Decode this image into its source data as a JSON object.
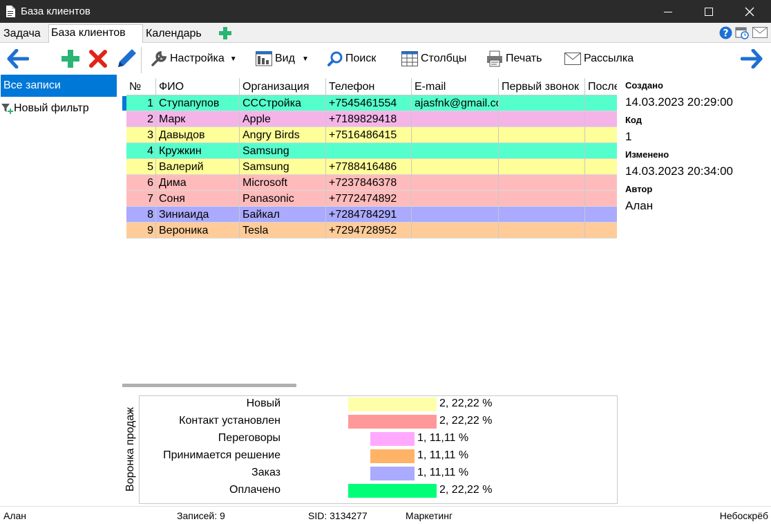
{
  "window": {
    "title": "База клиентов"
  },
  "tabs": [
    {
      "label": "Задача"
    },
    {
      "label": "База клиентов"
    },
    {
      "label": "Календарь"
    }
  ],
  "toolbar": {
    "settings_label": "Настройка",
    "view_label": "Вид",
    "search_label": "Поиск",
    "columns_label": "Столбцы",
    "print_label": "Печать",
    "mailing_label": "Рассылка"
  },
  "sidebar": {
    "all_records": "Все записи",
    "new_filter": "Новый фильтр"
  },
  "table": {
    "columns": [
      "№",
      "ФИО",
      "Организация",
      "Телефон",
      "E-mail",
      "Первый звонок",
      "Последний"
    ],
    "rows": [
      {
        "num": "1",
        "name": "Ступапупов",
        "org": "СССтройка",
        "phone": "+7545461554",
        "email": "ajasfnk@gmail.com",
        "first_call": "",
        "last": "",
        "color": "#55ffcc"
      },
      {
        "num": "2",
        "name": "Марк",
        "org": "Apple",
        "phone": "+7189829418",
        "email": "",
        "first_call": "",
        "last": "",
        "color": "#f4b4e8"
      },
      {
        "num": "3",
        "name": "Давыдов",
        "org": "Angry Birds",
        "phone": "+7516486415",
        "email": "",
        "first_call": "",
        "last": "",
        "color": "#ffff99"
      },
      {
        "num": "4",
        "name": "Кружкин",
        "org": "Samsung",
        "phone": "",
        "email": "",
        "first_call": "",
        "last": "",
        "color": "#55ffcc"
      },
      {
        "num": "5",
        "name": "Валерий",
        "org": "Samsung",
        "phone": "+7788416486",
        "email": "",
        "first_call": "",
        "last": "",
        "color": "#ffff99"
      },
      {
        "num": "6",
        "name": "Дима",
        "org": "Microsoft",
        "phone": "+7237846378",
        "email": "",
        "first_call": "",
        "last": "",
        "color": "#ffbbbb"
      },
      {
        "num": "7",
        "name": "Соня",
        "org": "Panasonic",
        "phone": "+7772474892",
        "email": "",
        "first_call": "",
        "last": "",
        "color": "#ffbbbb"
      },
      {
        "num": "8",
        "name": "Зиниаида",
        "org": "Байкал",
        "phone": "+7284784291",
        "email": "",
        "first_call": "",
        "last": "",
        "color": "#aaaaff"
      },
      {
        "num": "9",
        "name": "Вероника",
        "org": "Tesla",
        "phone": "+7294728952",
        "email": "",
        "first_call": "",
        "last": "",
        "color": "#ffcc99"
      }
    ]
  },
  "details": {
    "created_label": "Создано",
    "created_value": "14.03.2023 20:29:00",
    "code_label": "Код",
    "code_value": "1",
    "modified_label": "Изменено",
    "modified_value": "14.03.2023 20:34:00",
    "author_label": "Автор",
    "author_value": "Алан"
  },
  "funnel": {
    "title": "Воронка продаж",
    "stages": [
      {
        "name": "Новый",
        "count": 2,
        "value_text": "2, 22,22 %",
        "color": "#ffffaa"
      },
      {
        "name": "Контакт установлен",
        "count": 2,
        "value_text": "2, 22,22 %",
        "color": "#ff9999"
      },
      {
        "name": "Переговоры",
        "count": 1,
        "value_text": "1, 11,11 %",
        "color": "#ffaaff"
      },
      {
        "name": "Принимается решение",
        "count": 1,
        "value_text": "1, 11,11 %",
        "color": "#ffb366"
      },
      {
        "name": "Заказ",
        "count": 1,
        "value_text": "1, 11,11 %",
        "color": "#aaaaff"
      },
      {
        "name": "Оплачено",
        "count": 2,
        "value_text": "2, 22,22 %",
        "color": "#00ff77"
      }
    ]
  },
  "statusbar": {
    "user": "Алан",
    "records": "Записей: 9",
    "sid": "SID: 3134277",
    "department": "Маркетинг",
    "server": "Небоскрёб"
  },
  "colors": {
    "accent": "#0078d7",
    "titlebar": "#2b2b2b"
  }
}
